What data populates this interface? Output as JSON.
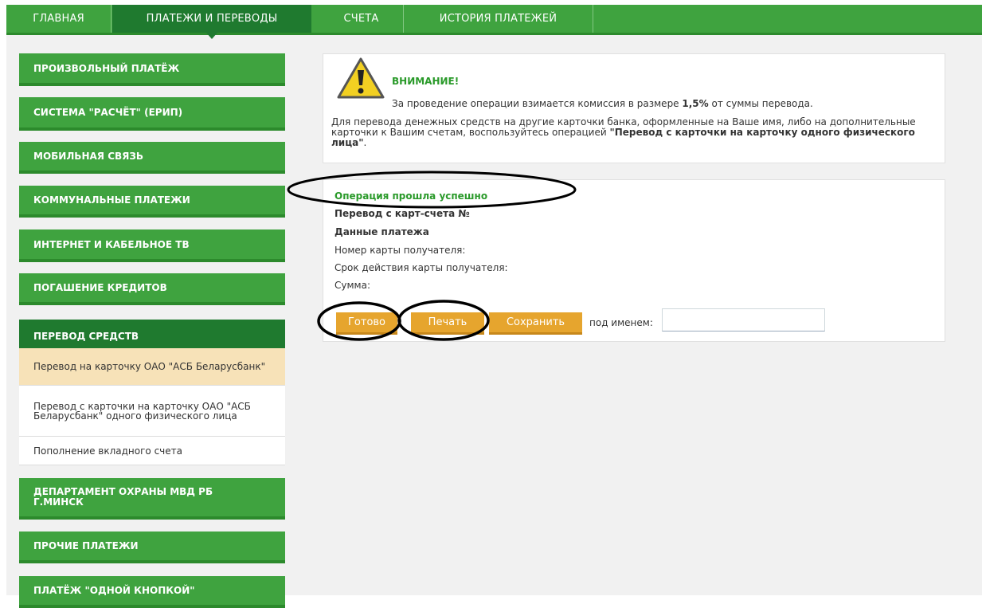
{
  "topnav": {
    "tabs": [
      {
        "label": "ГЛАВНАЯ"
      },
      {
        "label": "ПЛАТЕЖИ И ПЕРЕВОДЫ"
      },
      {
        "label": "СЧЕТА"
      },
      {
        "label": "ИСТОРИЯ ПЛАТЕЖЕЙ"
      }
    ],
    "active_index": 1
  },
  "sidebar": {
    "items": [
      {
        "label": "ПРОИЗВОЛЬНЫЙ ПЛАТЁЖ"
      },
      {
        "label": "СИСТЕМА \"РАСЧЁТ\" (ЕРИП)"
      },
      {
        "label": "МОБИЛЬНАЯ СВЯЗЬ"
      },
      {
        "label": "КОММУНАЛЬНЫЕ ПЛАТЕЖИ"
      },
      {
        "label": "ИНТЕРНЕТ И КАБЕЛЬНОЕ ТВ"
      },
      {
        "label": "ПОГАШЕНИЕ КРЕДИТОВ"
      }
    ],
    "active_section": {
      "label": "ПЕРЕВОД СРЕДСТВ",
      "subitems": [
        {
          "label": "Перевод на карточку ОАО \"АСБ Беларусбанк\"",
          "selected": true
        },
        {
          "label": "Перевод с карточки на карточку ОАО \"АСБ Беларусбанк\" одного физического лица",
          "selected": false
        },
        {
          "label": "Пополнение вкладного счета",
          "selected": false
        }
      ]
    },
    "items_after": [
      {
        "label": "ДЕПАРТАМЕНТ ОХРАНЫ МВД РБ Г.МИНСК"
      },
      {
        "label": "ПРОЧИЕ ПЛАТЕЖИ"
      },
      {
        "label": "ПЛАТЁЖ \"ОДНОЙ КНОПКОЙ\""
      }
    ]
  },
  "warning": {
    "icon": "warning-triangle-icon",
    "title": "ВНИМАНИЕ!",
    "line1_pre": "За проведение операции взимается комиссия в размере ",
    "line1_bold": "1,5%",
    "line1_post": " от суммы перевода.",
    "line2_pre": "Для перевода денежных средств на другие карточки банка, оформленные на Ваше имя, либо на дополнительные карточки к Вашим счетам, воспользуйтесь операцией ",
    "line2_bold": "\"Перевод с карточки на карточку одного физического лица\"",
    "line2_post": "."
  },
  "result": {
    "success": "Операция прошла успешно",
    "transfer_from": "Перевод с карт-счета №",
    "details_heading": "Данные платежа",
    "card_number_label": "Номер карты получателя:",
    "expiry_label": "Срок действия карты получателя:",
    "amount_label": "Сумма:"
  },
  "actions": {
    "done": "Готово",
    "print": "Печать",
    "save": "Сохранить",
    "name_label": "под именем:",
    "name_value": ""
  },
  "colors": {
    "brand_green": "#3fa33f",
    "dark_green": "#1f7a2f",
    "button_orange": "#e6a52e",
    "selected_bg": "#f7e2b8"
  }
}
